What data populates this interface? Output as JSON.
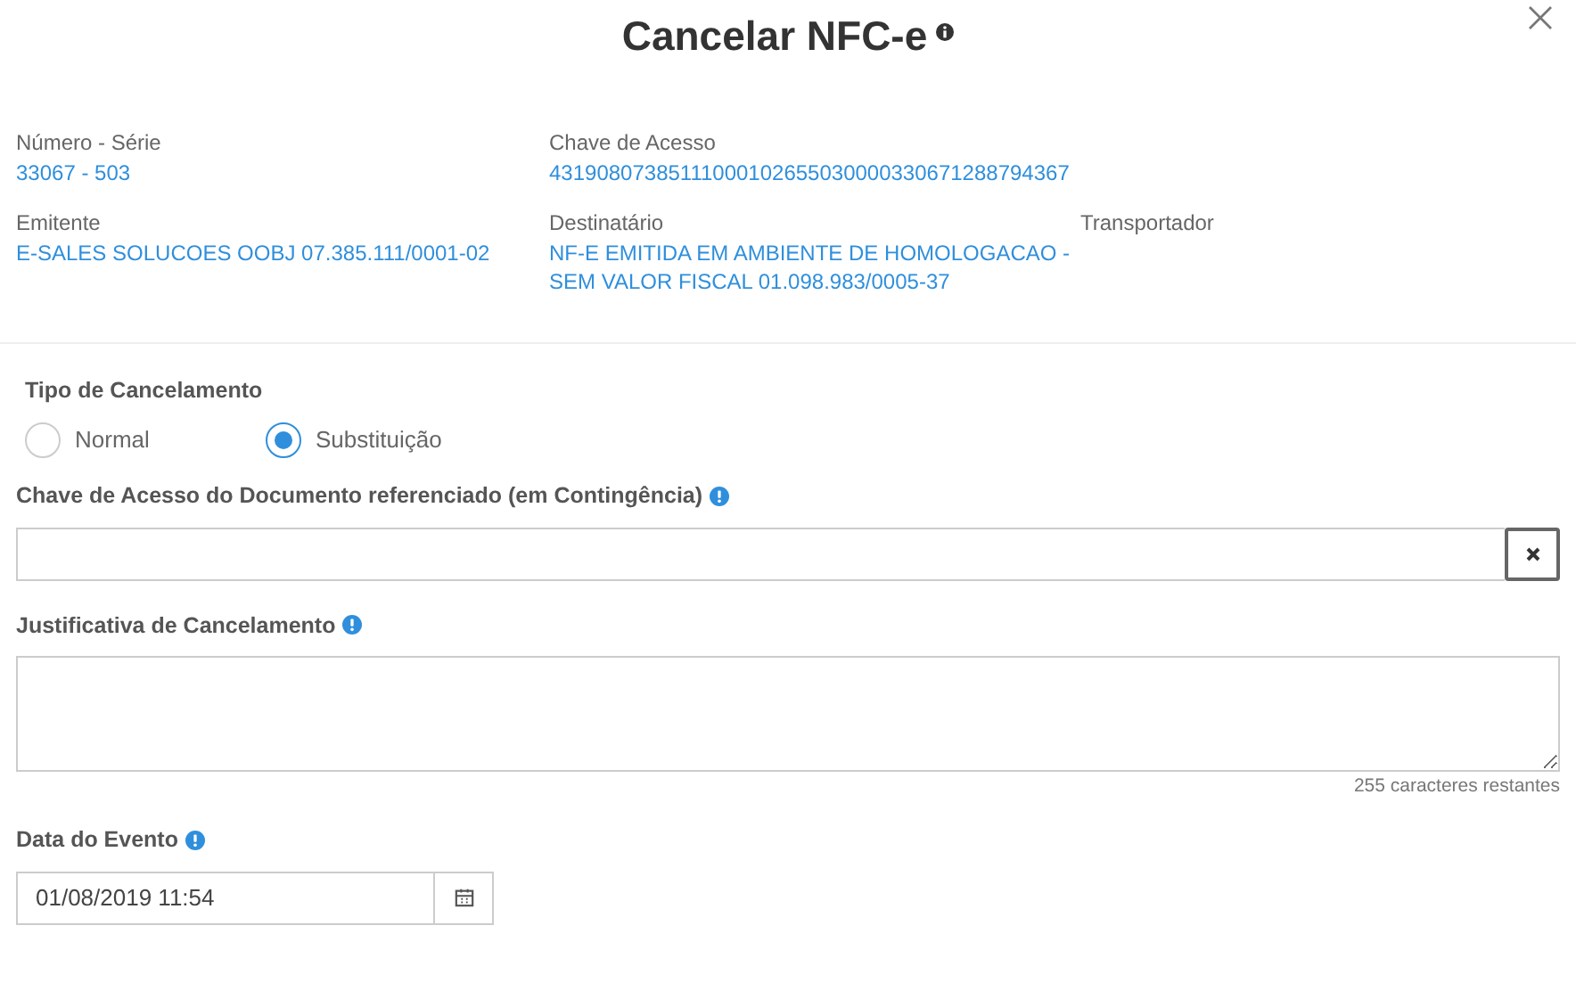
{
  "dialog": {
    "title": "Cancelar NFC-e"
  },
  "info": [
    [
      {
        "label": "Número - Série",
        "value": "33067 - 503"
      },
      {
        "label": "Chave de Acesso",
        "value": "43190807385111000102655030000330671288794367"
      }
    ],
    [
      {
        "label": "Emitente",
        "value": "E-SALES SOLUCOES OOBJ 07.385.111/0001-02"
      },
      {
        "label": "Destinatário",
        "value": "NF-E EMITIDA EM AMBIENTE DE HOMOLOGACAO - SEM VALOR FISCAL 01.098.983/0005-37"
      },
      {
        "label": "Transportador"
      }
    ]
  ],
  "cancel_type": {
    "label": "Tipo de Cancelamento",
    "options": [
      {
        "label": "Normal",
        "selected": false
      },
      {
        "label": "Substituição",
        "selected": true
      }
    ]
  },
  "reference_key": {
    "label": "Chave de Acesso do Documento referenciado (em Contingência)"
  },
  "justification": {
    "label": "Justificativa de Cancelamento",
    "counter": "255 caracteres restantes"
  },
  "event_date": {
    "label": "Data do Evento",
    "value": "01/08/2019 11:54"
  }
}
